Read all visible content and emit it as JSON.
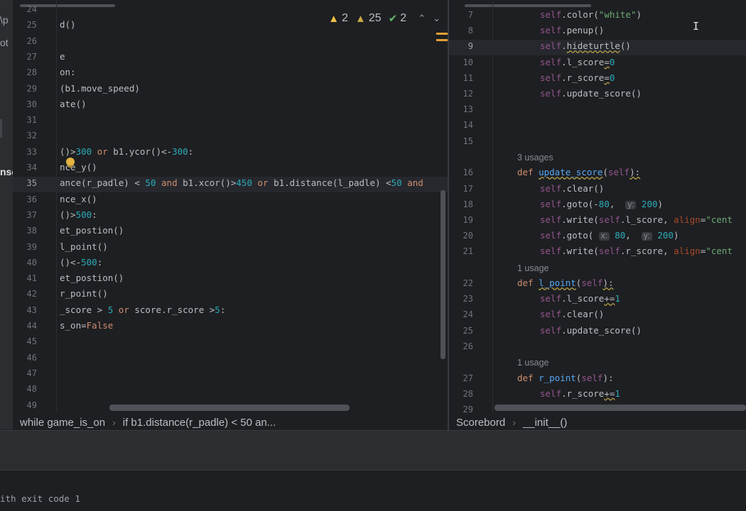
{
  "sidebar_fragments": [
    {
      "text": "\\p",
      "bold": false
    },
    {
      "text": "ot",
      "bold": false
    },
    {
      "text": "nse",
      "bold": true
    }
  ],
  "inspections": {
    "warnings": "2",
    "weak_warnings": "25",
    "ok": "2",
    "up": "⌃",
    "down": "⌄"
  },
  "left_editor": {
    "current_line": "35",
    "lines": [
      {
        "n": "24",
        "segs": []
      },
      {
        "n": "25",
        "segs": [
          {
            "t": "d()"
          }
        ]
      },
      {
        "n": "26",
        "segs": []
      },
      {
        "n": "27",
        "segs": [
          {
            "t": "e"
          }
        ]
      },
      {
        "n": "28",
        "segs": [
          {
            "t": "on:"
          }
        ]
      },
      {
        "n": "29",
        "segs": [
          {
            "t": "(b1.move_speed)"
          }
        ]
      },
      {
        "n": "30",
        "segs": [
          {
            "t": "ate()"
          }
        ]
      },
      {
        "n": "31",
        "segs": []
      },
      {
        "n": "32",
        "segs": []
      },
      {
        "n": "33",
        "segs": [
          {
            "t": "()>"
          },
          {
            "t": "300",
            "c": "num"
          },
          {
            "t": " "
          },
          {
            "t": "or",
            "c": "kw"
          },
          {
            "t": " b1.ycor()<-"
          },
          {
            "t": "300",
            "c": "num"
          },
          {
            "t": ":"
          }
        ]
      },
      {
        "n": "34",
        "segs": [
          {
            "t": "nce_y()"
          }
        ]
      },
      {
        "n": "35",
        "segs": [
          {
            "t": "ance(r_padle) < "
          },
          {
            "t": "50",
            "c": "num"
          },
          {
            "t": " "
          },
          {
            "t": "and",
            "c": "kw"
          },
          {
            "t": " b1.xcor()>"
          },
          {
            "t": "450",
            "c": "num"
          },
          {
            "t": " "
          },
          {
            "t": "or",
            "c": "kw"
          },
          {
            "t": " b1.distance(l_padle) <"
          },
          {
            "t": "50",
            "c": "num"
          },
          {
            "t": " "
          },
          {
            "t": "and",
            "c": "kw"
          }
        ]
      },
      {
        "n": "36",
        "segs": [
          {
            "t": "nce_x()"
          }
        ]
      },
      {
        "n": "37",
        "segs": [
          {
            "t": "()>"
          },
          {
            "t": "500",
            "c": "num"
          },
          {
            "t": ":"
          }
        ]
      },
      {
        "n": "38",
        "segs": [
          {
            "t": "et_postion()"
          }
        ]
      },
      {
        "n": "39",
        "segs": [
          {
            "t": "l_point()"
          }
        ]
      },
      {
        "n": "40",
        "segs": [
          {
            "t": "()<-"
          },
          {
            "t": "500",
            "c": "num"
          },
          {
            "t": ":"
          }
        ]
      },
      {
        "n": "41",
        "segs": [
          {
            "t": "et_postion()"
          }
        ]
      },
      {
        "n": "42",
        "segs": [
          {
            "t": "r_point()"
          }
        ]
      },
      {
        "n": "43",
        "segs": [
          {
            "t": "_score > "
          },
          {
            "t": "5",
            "c": "num"
          },
          {
            "t": " "
          },
          {
            "t": "or",
            "c": "kw"
          },
          {
            "t": " score.r_score >"
          },
          {
            "t": "5",
            "c": "num"
          },
          {
            "t": ":"
          }
        ]
      },
      {
        "n": "44",
        "segs": [
          {
            "t": "s_on="
          },
          {
            "t": "False",
            "c": "kw"
          }
        ]
      },
      {
        "n": "45",
        "segs": []
      },
      {
        "n": "46",
        "segs": []
      },
      {
        "n": "47",
        "segs": []
      },
      {
        "n": "48",
        "segs": []
      },
      {
        "n": "49",
        "segs": []
      }
    ]
  },
  "right_editor": {
    "current_line": "9",
    "rows": [
      {
        "n": "7",
        "indent": 2,
        "segs": [
          {
            "t": "self",
            "c": "self"
          },
          {
            "t": ".color("
          },
          {
            "t": "\"white\"",
            "c": "str"
          },
          {
            "t": ")"
          }
        ]
      },
      {
        "n": "8",
        "indent": 2,
        "segs": [
          {
            "t": "self",
            "c": "self"
          },
          {
            "t": ".penup()"
          }
        ]
      },
      {
        "n": "9",
        "indent": 2,
        "segs": [
          {
            "t": "self",
            "c": "self"
          },
          {
            "t": "."
          },
          {
            "t": "hideturtle",
            "c": "ul"
          },
          {
            "t": "()"
          }
        ]
      },
      {
        "n": "10",
        "indent": 2,
        "segs": [
          {
            "t": "self",
            "c": "self"
          },
          {
            "t": ".l_score"
          },
          {
            "t": "=",
            "c": "ul"
          },
          {
            "t": "0",
            "c": "num"
          }
        ]
      },
      {
        "n": "11",
        "indent": 2,
        "segs": [
          {
            "t": "self",
            "c": "self"
          },
          {
            "t": ".r_score"
          },
          {
            "t": "=",
            "c": "ul"
          },
          {
            "t": "0",
            "c": "num"
          }
        ]
      },
      {
        "n": "12",
        "indent": 2,
        "segs": [
          {
            "t": "self",
            "c": "self"
          },
          {
            "t": ".update_score()"
          }
        ]
      },
      {
        "n": "13",
        "indent": 0,
        "segs": []
      },
      {
        "n": "14",
        "indent": 0,
        "segs": []
      },
      {
        "n": "15",
        "indent": 0,
        "segs": []
      },
      {
        "hint": "3 usages"
      },
      {
        "n": "16",
        "indent": 1,
        "segs": [
          {
            "t": "def",
            "c": "kw"
          },
          {
            "t": " "
          },
          {
            "t": "update_score",
            "c": "fnul"
          },
          {
            "t": "("
          },
          {
            "t": "self",
            "c": "self"
          },
          {
            "t": "):",
            "c": "ul"
          }
        ]
      },
      {
        "n": "17",
        "indent": 2,
        "segs": [
          {
            "t": "self",
            "c": "self"
          },
          {
            "t": ".clear()"
          }
        ]
      },
      {
        "n": "18",
        "indent": 2,
        "segs": [
          {
            "t": "self",
            "c": "self"
          },
          {
            "t": ".goto(-"
          },
          {
            "t": "80",
            "c": "num"
          },
          {
            "t": ",  "
          },
          {
            "t": "y:",
            "c": "inlay"
          },
          {
            "t": " "
          },
          {
            "t": "200",
            "c": "num"
          },
          {
            "t": ")"
          }
        ]
      },
      {
        "n": "19",
        "indent": 2,
        "segs": [
          {
            "t": "self",
            "c": "self"
          },
          {
            "t": ".write("
          },
          {
            "t": "self",
            "c": "self"
          },
          {
            "t": ".l_score, "
          },
          {
            "t": "align",
            "c": "param"
          },
          {
            "t": "="
          },
          {
            "t": "\"cent",
            "c": "str"
          }
        ]
      },
      {
        "n": "20",
        "indent": 2,
        "segs": [
          {
            "t": "self",
            "c": "self"
          },
          {
            "t": ".goto( "
          },
          {
            "t": "x:",
            "c": "inlay"
          },
          {
            "t": " "
          },
          {
            "t": "80",
            "c": "num"
          },
          {
            "t": ",  "
          },
          {
            "t": "y:",
            "c": "inlay"
          },
          {
            "t": " "
          },
          {
            "t": "200",
            "c": "num"
          },
          {
            "t": ")"
          }
        ]
      },
      {
        "n": "21",
        "indent": 2,
        "segs": [
          {
            "t": "self",
            "c": "self"
          },
          {
            "t": ".write("
          },
          {
            "t": "self",
            "c": "self"
          },
          {
            "t": ".r_score, "
          },
          {
            "t": "align",
            "c": "param"
          },
          {
            "t": "="
          },
          {
            "t": "\"cent",
            "c": "str"
          }
        ]
      },
      {
        "hint": "1 usage"
      },
      {
        "n": "22",
        "indent": 1,
        "segs": [
          {
            "t": "def",
            "c": "kw"
          },
          {
            "t": " "
          },
          {
            "t": "l_point",
            "c": "fnul"
          },
          {
            "t": "("
          },
          {
            "t": "self",
            "c": "self"
          },
          {
            "t": "):",
            "c": "ul"
          }
        ]
      },
      {
        "n": "23",
        "indent": 2,
        "segs": [
          {
            "t": "self",
            "c": "self"
          },
          {
            "t": ".l_score"
          },
          {
            "t": "+=",
            "c": "ul"
          },
          {
            "t": "1",
            "c": "num"
          }
        ]
      },
      {
        "n": "24",
        "indent": 2,
        "segs": [
          {
            "t": "self",
            "c": "self"
          },
          {
            "t": ".clear()"
          }
        ]
      },
      {
        "n": "25",
        "indent": 2,
        "segs": [
          {
            "t": "self",
            "c": "self"
          },
          {
            "t": ".update_score()"
          }
        ]
      },
      {
        "n": "26",
        "indent": 0,
        "segs": []
      },
      {
        "hint": "1 usage"
      },
      {
        "n": "27",
        "indent": 1,
        "segs": [
          {
            "t": "def",
            "c": "kw"
          },
          {
            "t": " "
          },
          {
            "t": "r_point",
            "c": "fn"
          },
          {
            "t": "("
          },
          {
            "t": "self",
            "c": "self"
          },
          {
            "t": "):"
          }
        ]
      },
      {
        "n": "28",
        "indent": 2,
        "segs": [
          {
            "t": "self",
            "c": "self"
          },
          {
            "t": ".r_score"
          },
          {
            "t": "+=",
            "c": "ul"
          },
          {
            "t": "1",
            "c": "num"
          }
        ]
      },
      {
        "n": "29",
        "indent": 0,
        "segs": []
      }
    ]
  },
  "breadcrumbs": {
    "left": [
      "while game_is_on",
      "if b1.distance(r_padle) < 50 an..."
    ],
    "right": [
      "Scorebord",
      "__init__()"
    ],
    "separator": "›"
  },
  "console": {
    "partial_text": "ith exit code 1"
  }
}
